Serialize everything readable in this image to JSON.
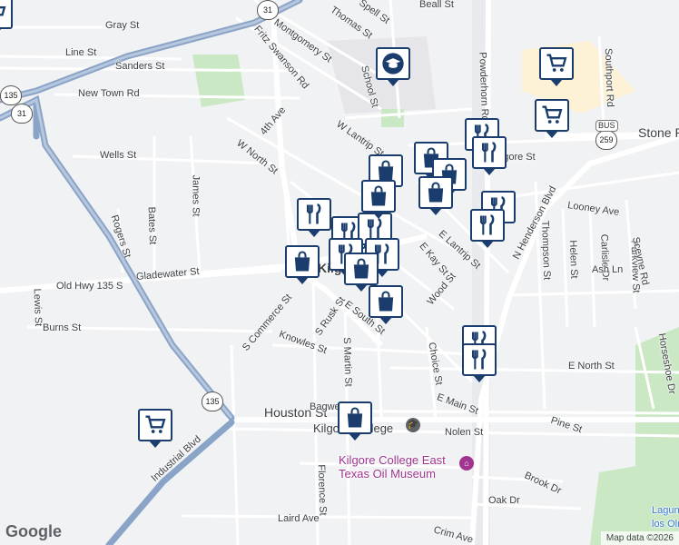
{
  "map": {
    "street_labels": [
      {
        "text": "Spell St"
      },
      {
        "text": "Thomas St"
      },
      {
        "text": "Gray St"
      },
      {
        "text": "Montgomery St"
      },
      {
        "text": "Fritz Swanson Rd"
      },
      {
        "text": "Line St"
      },
      {
        "text": "Sanders St"
      },
      {
        "text": "New Town Rd"
      },
      {
        "text": "4th Ave"
      },
      {
        "text": "School St"
      },
      {
        "text": "W Lantrip St"
      },
      {
        "text": "Powderhorn Rd"
      },
      {
        "text": "Southport Rd"
      },
      {
        "text": "Stone Rd"
      },
      {
        "text": "Wells St"
      },
      {
        "text": "W North St"
      },
      {
        "text": "James St"
      },
      {
        "text": "Rogers St"
      },
      {
        "text": "Bates St"
      },
      {
        "text": "Gladewater St"
      },
      {
        "text": "Old Hwy 135 S"
      },
      {
        "text": "Lewis St"
      },
      {
        "text": "Burns St"
      },
      {
        "text": "S Commerce St"
      },
      {
        "text": "Knowles St"
      },
      {
        "text": "S Rusk St"
      },
      {
        "text": "E South St"
      },
      {
        "text": "S Martin St"
      },
      {
        "text": "Wood St"
      },
      {
        "text": "E Kay St"
      },
      {
        "text": "E Lantrip St"
      },
      {
        "text": "N Henderson Blvd"
      },
      {
        "text": "Looney Ave"
      },
      {
        "text": "Thompson St"
      },
      {
        "text": "Carlisle Dr"
      },
      {
        "text": "Helen St"
      },
      {
        "text": "Parkview St"
      },
      {
        "text": "Sceyne Rd"
      },
      {
        "text": "Ash Ln"
      },
      {
        "text": "E North St"
      },
      {
        "text": "Choice St"
      },
      {
        "text": "E Main St"
      },
      {
        "text": "Houston St"
      },
      {
        "text": "Bagwell St"
      },
      {
        "text": "Industrial Blvd"
      },
      {
        "text": "Nolen St"
      },
      {
        "text": "Florence St"
      },
      {
        "text": "Laird Ave"
      },
      {
        "text": "Brook Dr"
      },
      {
        "text": "Oak Dr"
      },
      {
        "text": "Crim Ave"
      },
      {
        "text": "Pine St"
      },
      {
        "text": "Horseshoe Dr"
      },
      {
        "text": "Kilgore St"
      },
      {
        "text": "Beall St"
      }
    ],
    "city_label": "Kilgore",
    "pois": [
      {
        "name": "Kilgore College"
      },
      {
        "name": "Kilgore College East"
      },
      {
        "name": "Texas Oil Museum"
      },
      {
        "name": "Laguna"
      },
      {
        "name": "los Olm"
      }
    ],
    "shields": [
      {
        "label": "31"
      },
      {
        "label": "135"
      },
      {
        "label": "31"
      },
      {
        "label": "135"
      },
      {
        "label": "259"
      },
      {
        "label": "BUS"
      }
    ],
    "markers": [
      {
        "icon": "cart-icon"
      },
      {
        "icon": "cart-icon"
      },
      {
        "icon": "cart-icon"
      },
      {
        "icon": "school-icon"
      },
      {
        "icon": "restaurant-icon"
      },
      {
        "icon": "restaurant-icon"
      },
      {
        "icon": "restaurant-icon"
      },
      {
        "icon": "restaurant-icon"
      },
      {
        "icon": "restaurant-icon"
      },
      {
        "icon": "restaurant-icon"
      },
      {
        "icon": "restaurant-icon"
      },
      {
        "icon": "restaurant-icon"
      },
      {
        "icon": "restaurant-icon"
      },
      {
        "icon": "shopping-bag-icon"
      },
      {
        "icon": "shopping-bag-icon"
      },
      {
        "icon": "shopping-bag-icon"
      },
      {
        "icon": "shopping-bag-icon"
      },
      {
        "icon": "shopping-bag-icon"
      },
      {
        "icon": "shopping-bag-icon"
      },
      {
        "icon": "shopping-bag-icon"
      },
      {
        "icon": "shopping-bag-icon"
      }
    ],
    "attribution": "Map data ©2026",
    "logo": "Google",
    "colors": {
      "background": "#f1f2f4",
      "road": "#ffffff",
      "highway": "#8aa4c8",
      "park": "#c9e8c3",
      "campus": "#fdf1d6",
      "marker": "#1a3d6e"
    }
  }
}
